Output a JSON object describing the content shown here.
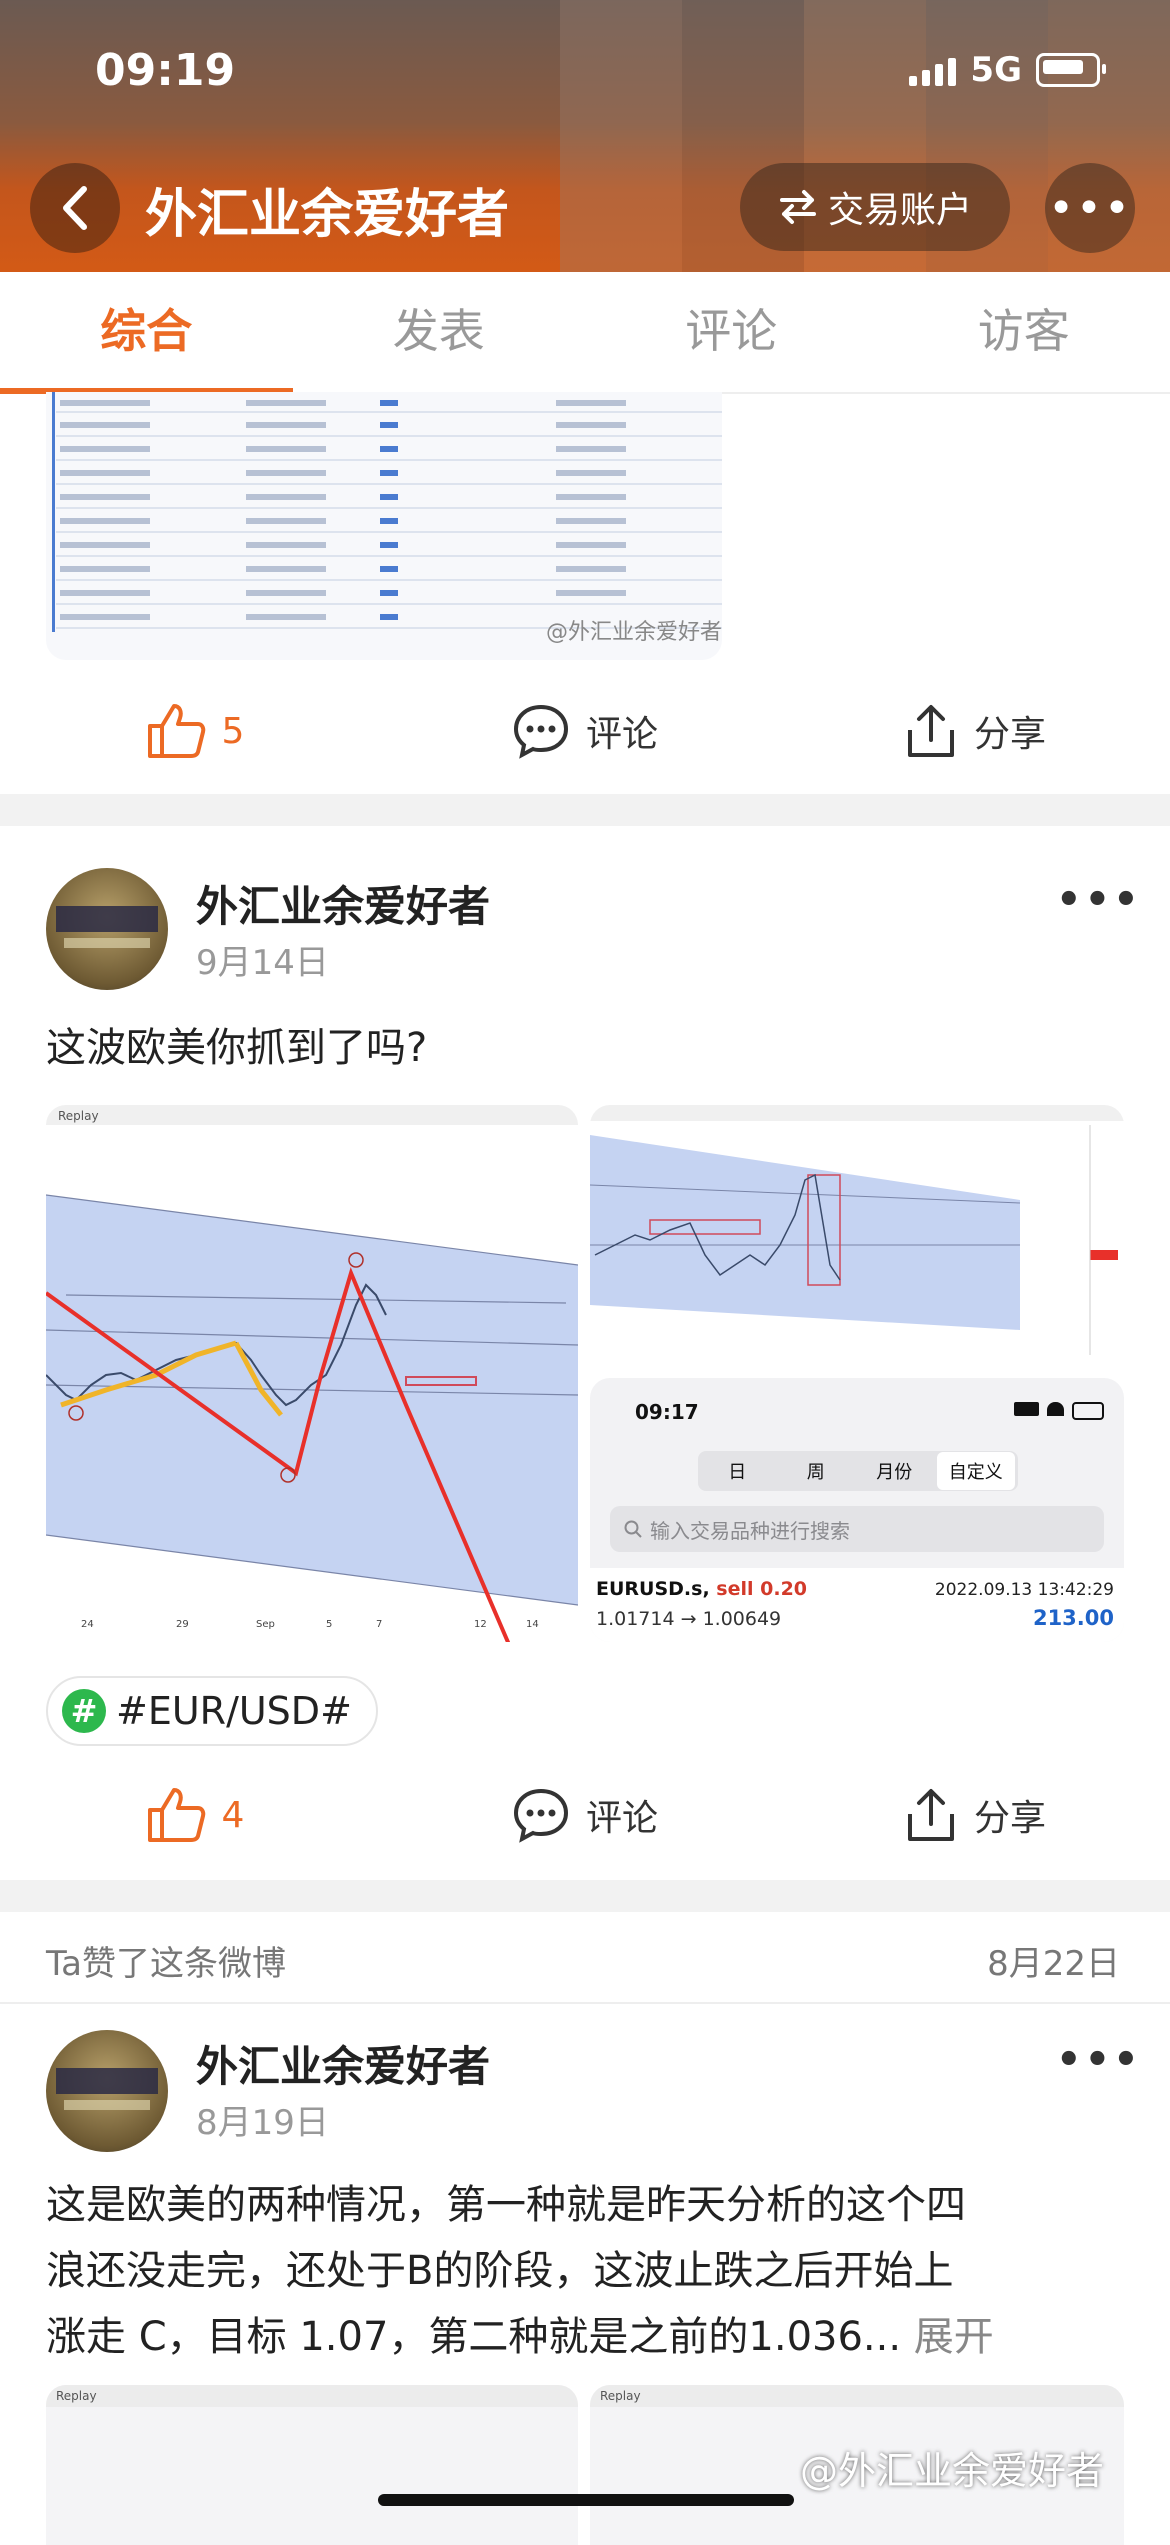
{
  "status_bar": {
    "time": "09:19",
    "network": "5G"
  },
  "header": {
    "title": "外汇业余爱好者",
    "trade_button": "交易账户"
  },
  "tabs": [
    "综合",
    "发表",
    "评论",
    "访客"
  ],
  "post1": {
    "watermark": "@外汇业余爱好者",
    "actions": {
      "like_count": "5",
      "comment": "评论",
      "share": "分享"
    }
  },
  "post2": {
    "username": "外汇业余爱好者",
    "date": "9月14日",
    "text": "这波欧美你抓到了吗?",
    "images": {
      "replay_label": "Replay",
      "phone_time": "09:17",
      "segments": [
        "日",
        "周",
        "月份",
        "自定义"
      ],
      "search_placeholder": "输入交易品种进行搜索",
      "trade": {
        "symbol": "EURUSD.s,",
        "side": "sell 0.20",
        "datetime": "2022.09.13 13:42:29",
        "prices": "1.01714 → 1.00649",
        "profit": "213.00"
      },
      "axis_labels": [
        "24",
        "29",
        "Sep",
        "5",
        "7",
        "12",
        "14"
      ]
    },
    "topic": "#EUR/USD#",
    "actions": {
      "like_count": "4",
      "comment": "评论",
      "share": "分享"
    }
  },
  "liked_section": {
    "label": "Ta赞了这条微博",
    "date": "8月22日"
  },
  "post3": {
    "username": "外汇业余爱好者",
    "date": "8月19日",
    "text_lines": [
      "这是欧美的两种情况，第一种就是昨天分析的这个四",
      "浪还没走完，还处于B的阶段，这波止跌之后开始上",
      "涨走 C，目标 1.07，第二种就是之前的1.036..."
    ],
    "expand": "展开",
    "replay_label": "Replay",
    "watermark": "@外汇业余爱好者"
  }
}
